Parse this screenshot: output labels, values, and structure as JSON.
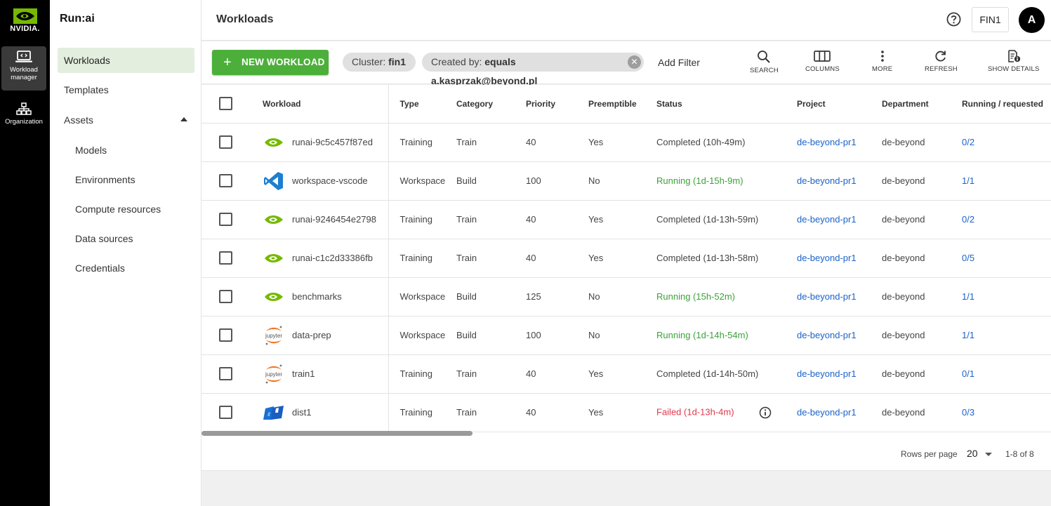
{
  "rail": {
    "brand": "NVIDIA.",
    "items": [
      {
        "label_line1": "Workload",
        "label_line2": "manager"
      },
      {
        "label_line1": "Organization",
        "label_line2": ""
      }
    ]
  },
  "nav": {
    "brand": "Run:ai",
    "items": [
      "Workloads",
      "Templates",
      "Assets"
    ],
    "assets": [
      "Models",
      "Environments",
      "Compute resources",
      "Data sources",
      "Credentials"
    ]
  },
  "header": {
    "title": "Workloads",
    "cluster": "FIN1",
    "avatar": "A"
  },
  "toolbar": {
    "new_label": "NEW WORKLOAD",
    "filter_cluster_key": "Cluster: ",
    "filter_cluster_val": "fin1",
    "filter_created_key": "Created by: ",
    "filter_created_val": "equals a.kasprzak@beyond.pl",
    "add_filter": "Add Filter",
    "tools": [
      "SEARCH",
      "COLUMNS",
      "MORE",
      "REFRESH",
      "SHOW DETAILS"
    ]
  },
  "table": {
    "columns": [
      "Workload",
      "Type",
      "Category",
      "Priority",
      "Preemptible",
      "Status",
      "Project",
      "Department",
      "Running / requested"
    ],
    "rows": [
      {
        "name": "runai-9c5c457f87ed",
        "icon": "nvidia-icon",
        "type": "Training",
        "category": "Train",
        "priority": "40",
        "preemptible": "Yes",
        "status": "Completed (10h-49m)",
        "state": "completed",
        "project": "de-beyond-pr1",
        "department": "de-beyond",
        "running": "0/2"
      },
      {
        "name": "workspace-vscode",
        "icon": "vscode-icon",
        "type": "Workspace",
        "category": "Build",
        "priority": "100",
        "preemptible": "No",
        "status": "Running (1d-15h-9m)",
        "state": "running",
        "project": "de-beyond-pr1",
        "department": "de-beyond",
        "running": "1/1"
      },
      {
        "name": "runai-9246454e2798",
        "icon": "nvidia-icon",
        "type": "Training",
        "category": "Train",
        "priority": "40",
        "preemptible": "Yes",
        "status": "Completed (1d-13h-59m)",
        "state": "completed",
        "project": "de-beyond-pr1",
        "department": "de-beyond",
        "running": "0/2"
      },
      {
        "name": "runai-c1c2d33386fb",
        "icon": "nvidia-icon",
        "type": "Training",
        "category": "Train",
        "priority": "40",
        "preemptible": "Yes",
        "status": "Completed (1d-13h-58m)",
        "state": "completed",
        "project": "de-beyond-pr1",
        "department": "de-beyond",
        "running": "0/5"
      },
      {
        "name": "benchmarks",
        "icon": "nvidia-icon",
        "type": "Workspace",
        "category": "Build",
        "priority": "125",
        "preemptible": "No",
        "status": "Running (15h-52m)",
        "state": "running",
        "project": "de-beyond-pr1",
        "department": "de-beyond",
        "running": "1/1"
      },
      {
        "name": "data-prep",
        "icon": "jupyter-icon",
        "type": "Workspace",
        "category": "Build",
        "priority": "100",
        "preemptible": "No",
        "status": "Running (1d-14h-54m)",
        "state": "running",
        "project": "de-beyond-pr1",
        "department": "de-beyond",
        "running": "1/1"
      },
      {
        "name": "train1",
        "icon": "jupyter-icon",
        "type": "Training",
        "category": "Train",
        "priority": "40",
        "preemptible": "Yes",
        "status": "Completed (1d-14h-50m)",
        "state": "completed",
        "project": "de-beyond-pr1",
        "department": "de-beyond",
        "running": "0/1"
      },
      {
        "name": "dist1",
        "icon": "distributed-icon",
        "type": "Training",
        "category": "Train",
        "priority": "40",
        "preemptible": "Yes",
        "status": "Failed (1d-13h-4m)",
        "state": "failed",
        "project": "de-beyond-pr1",
        "department": "de-beyond",
        "running": "0/3"
      }
    ]
  },
  "footer": {
    "rows_per_page_label": "Rows per page",
    "rows_per_page_value": "20",
    "range": "1-8 of 8"
  },
  "colors": {
    "accent_green": "#4caf3a",
    "running": "#3da23a",
    "failed": "#e0394a",
    "link": "#1b63c9",
    "nvidia_green": "#76b900"
  }
}
